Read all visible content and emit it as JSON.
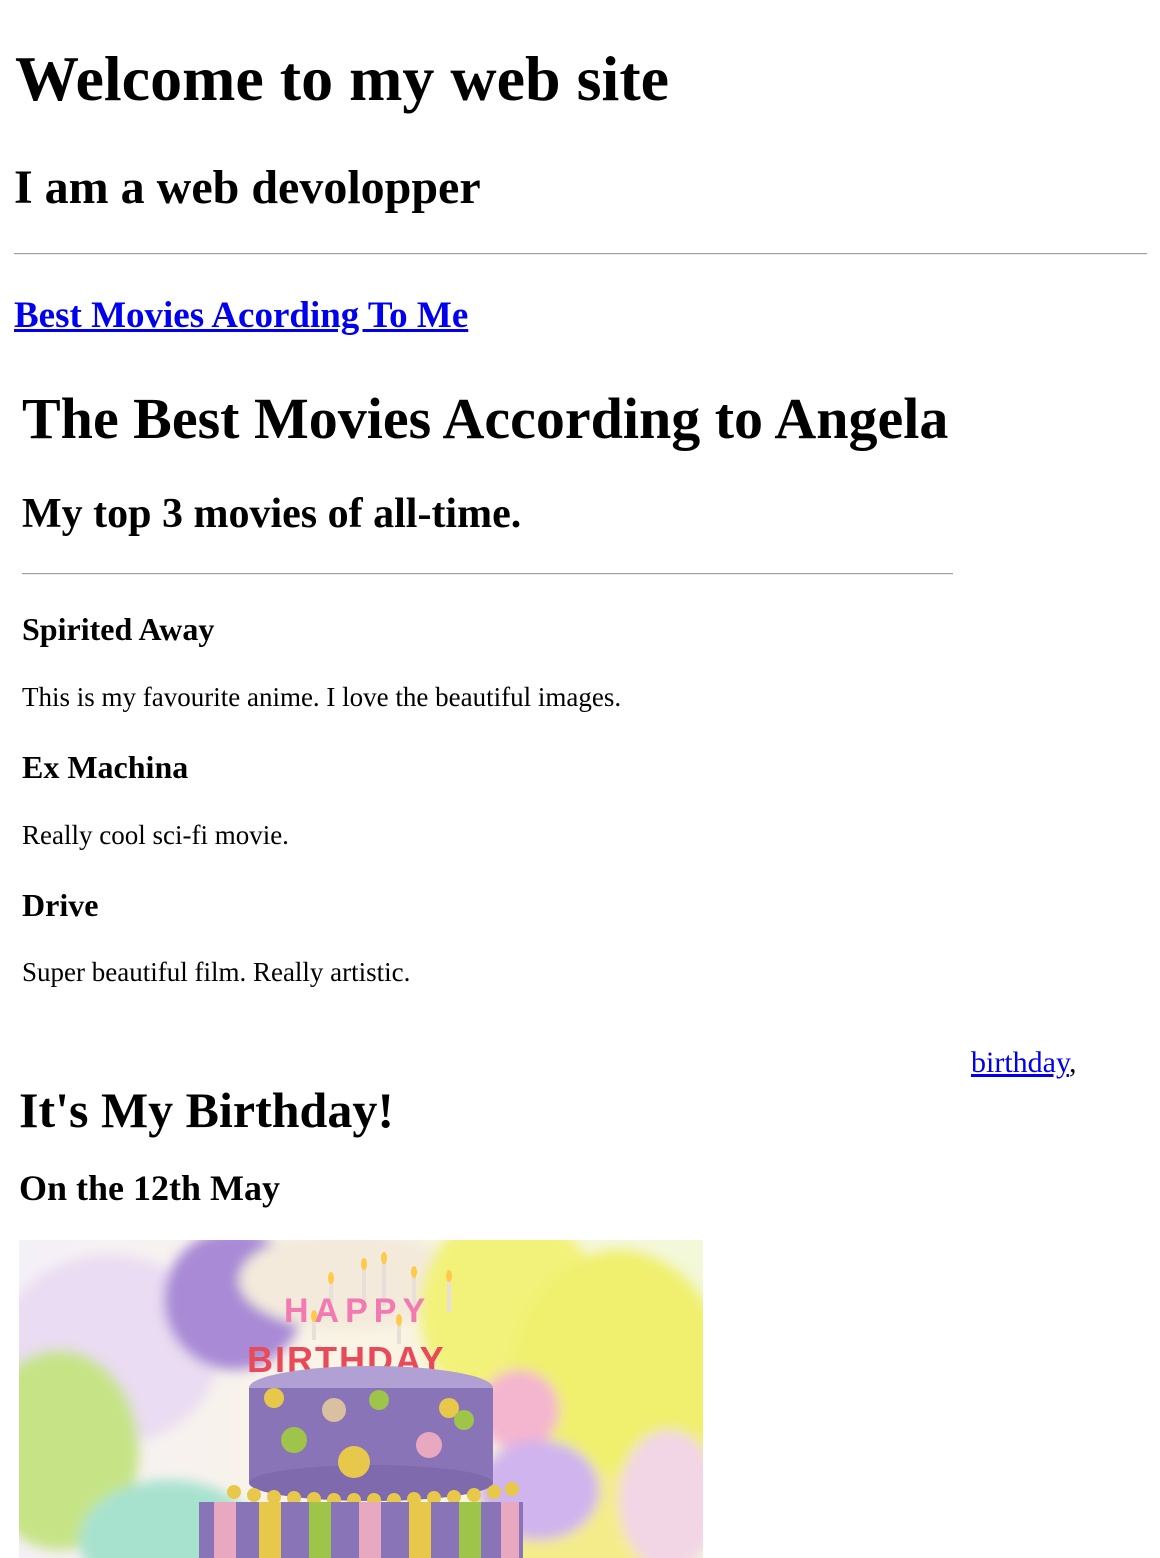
{
  "header": {
    "title": "Welcome to my web site",
    "subtitle": "I am a web devolopper"
  },
  "nav": {
    "movies_link": "Best Movies Acording To Me"
  },
  "movies": {
    "title": "The Best Movies According to Angela",
    "subtitle": "My top 3 movies of all-time.",
    "items": [
      {
        "title": "Spirited Away",
        "description": "This is my favourite anime. I love the beautiful images."
      },
      {
        "title": "Ex Machina",
        "description": "Really cool sci-fi movie."
      },
      {
        "title": "Drive",
        "description": "Super beautiful film. Really artistic."
      }
    ]
  },
  "birthday": {
    "link": "birthday",
    "link_suffix": ",",
    "title": "It's My Birthday!",
    "subtitle": "On the 12th May",
    "cake_text_top": "HAPPY",
    "cake_text_bottom": "BIRTHDAY"
  },
  "colors": {
    "link": "#0000ee",
    "cake_purple": "#8a74b8",
    "balloon_yellow": "#f0f060",
    "balloon_purple": "#b08ad8"
  }
}
